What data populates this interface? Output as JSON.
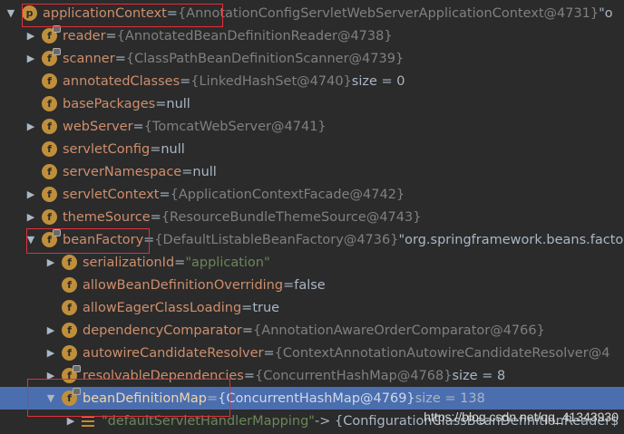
{
  "rows": [
    {
      "indent": 0,
      "arrow": "down",
      "badge": "p",
      "name": "applicationContext",
      "eq": " = ",
      "ref": "{AnnotationConfigServletWebServerApplicationContext@4731}",
      "extra": " \"o",
      "lock": false
    },
    {
      "indent": 1,
      "arrow": "right",
      "badge": "f",
      "name": "reader",
      "eq": " = ",
      "ref": "{AnnotatedBeanDefinitionReader@4738}",
      "extra": "",
      "lock": true
    },
    {
      "indent": 1,
      "arrow": "right",
      "badge": "f",
      "name": "scanner",
      "eq": " = ",
      "ref": "{ClassPathBeanDefinitionScanner@4739}",
      "extra": "",
      "lock": true
    },
    {
      "indent": 1,
      "arrow": "",
      "badge": "f",
      "name": "annotatedClasses",
      "eq": " = ",
      "ref": "{LinkedHashSet@4740}",
      "extra": "  size = 0",
      "lock": false
    },
    {
      "indent": 1,
      "arrow": "",
      "badge": "f",
      "name": "basePackages",
      "eq": " = ",
      "ref": "",
      "extra": "null",
      "lock": false
    },
    {
      "indent": 1,
      "arrow": "right",
      "badge": "f",
      "name": "webServer",
      "eq": " = ",
      "ref": "{TomcatWebServer@4741}",
      "extra": "",
      "lock": false
    },
    {
      "indent": 1,
      "arrow": "",
      "badge": "f",
      "name": "servletConfig",
      "eq": " = ",
      "ref": "",
      "extra": "null",
      "lock": false
    },
    {
      "indent": 1,
      "arrow": "",
      "badge": "f",
      "name": "serverNamespace",
      "eq": " = ",
      "ref": "",
      "extra": "null",
      "lock": false
    },
    {
      "indent": 1,
      "arrow": "right",
      "badge": "f",
      "name": "servletContext",
      "eq": " = ",
      "ref": "{ApplicationContextFacade@4742}",
      "extra": "",
      "lock": false
    },
    {
      "indent": 1,
      "arrow": "right",
      "badge": "f",
      "name": "themeSource",
      "eq": " = ",
      "ref": "{ResourceBundleThemeSource@4743}",
      "extra": "",
      "lock": false
    },
    {
      "indent": 1,
      "arrow": "down",
      "badge": "f",
      "name": "beanFactory",
      "eq": " = ",
      "ref": "{DefaultListableBeanFactory@4736}",
      "extra": " \"org.springframework.beans.facto",
      "lock": true
    },
    {
      "indent": 2,
      "arrow": "right",
      "badge": "f",
      "name": "serializationId",
      "eq": " = ",
      "ref": "",
      "extra": "",
      "str": "\"application\"",
      "lock": false
    },
    {
      "indent": 2,
      "arrow": "",
      "badge": "f",
      "name": "allowBeanDefinitionOverriding",
      "eq": " = ",
      "ref": "",
      "extra": "false",
      "lock": false
    },
    {
      "indent": 2,
      "arrow": "",
      "badge": "f",
      "name": "allowEagerClassLoading",
      "eq": " = ",
      "ref": "",
      "extra": "true",
      "lock": false
    },
    {
      "indent": 2,
      "arrow": "right",
      "badge": "f",
      "name": "dependencyComparator",
      "eq": " = ",
      "ref": "{AnnotationAwareOrderComparator@4766}",
      "extra": "",
      "lock": false
    },
    {
      "indent": 2,
      "arrow": "right",
      "badge": "f",
      "name": "autowireCandidateResolver",
      "eq": " = ",
      "ref": "{ContextAnnotationAutowireCandidateResolver@4",
      "extra": "",
      "lock": false
    },
    {
      "indent": 2,
      "arrow": "right",
      "badge": "f",
      "name": "resolvableDependencies",
      "eq": " = ",
      "ref": "{ConcurrentHashMap@4768}",
      "extra": "  size = 8",
      "lock": true
    },
    {
      "indent": 2,
      "arrow": "down",
      "badge": "f",
      "name": "beanDefinitionMap",
      "eq": " = ",
      "ref": "{ConcurrentHashMap@4769}",
      "extra": "  size = 138",
      "lock": true,
      "selected": true
    },
    {
      "indent": 3,
      "arrow": "right",
      "badge": "list",
      "name": "",
      "eq": "",
      "ref": "",
      "extra": " -> {ConfigurationClassBeanDefinitionReader$",
      "str": "\"defaultServletHandlerMapping\"",
      "lock": false
    }
  ],
  "watermark": "https://blog.csdn.net/qq_41343930",
  "colors": {
    "background": "#2b2b2b",
    "selection": "#4b6eaf",
    "field": "#cf8e6d",
    "reference": "#808080",
    "string": "#6a8759",
    "highlight_box": "#e0303a"
  }
}
